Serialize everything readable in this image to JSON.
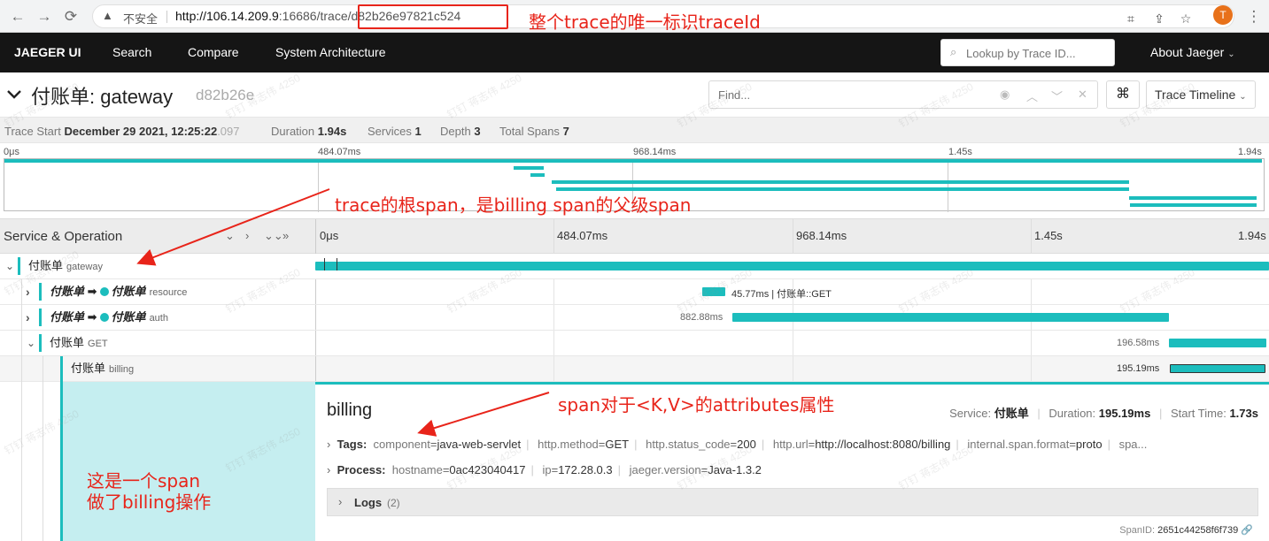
{
  "browser": {
    "insecure_label": "不安全",
    "url_host": "http://106.14.209.9",
    "url_rest": ":16686/trace/d82b26e97821c524"
  },
  "nav": {
    "brand": "JAEGER UI",
    "search": "Search",
    "compare": "Compare",
    "system_architecture": "System Architecture",
    "lookup_placeholder": "Lookup by Trace ID...",
    "about": "About Jaeger"
  },
  "trace": {
    "title": "付账单: gateway",
    "short_id": "d82b26e",
    "find_placeholder": "Find...",
    "view_mode": "Trace Timeline",
    "summary": {
      "trace_start_label": "Trace Start",
      "trace_start_value": "December 29 2021, 12:25:22",
      "trace_start_ms": ".097",
      "duration_label": "Duration",
      "duration_value": "1.94s",
      "services_label": "Services",
      "services_value": "1",
      "depth_label": "Depth",
      "depth_value": "3",
      "total_spans_label": "Total Spans",
      "total_spans_value": "7"
    }
  },
  "ticks": [
    "0μs",
    "484.07ms",
    "968.14ms",
    "1.45s",
    "1.94s"
  ],
  "timeline_header": {
    "title": "Service & Operation"
  },
  "rows": [
    {
      "service": "付账单",
      "operation": "gateway"
    },
    {
      "service": "付账单",
      "target": "付账单",
      "operation": "resource",
      "bar_label": "45.77ms | 付账单::GET"
    },
    {
      "service": "付账单",
      "target": "付账单",
      "operation": "auth",
      "bar_label": "882.88ms"
    },
    {
      "service": "付账单",
      "operation": "GET",
      "bar_label": "196.58ms"
    },
    {
      "service": "付账单",
      "operation": "billing",
      "bar_label": "195.19ms"
    }
  ],
  "detail": {
    "title": "billing",
    "service_label": "Service:",
    "service_value": "付账单",
    "duration_label": "Duration:",
    "duration_value": "195.19ms",
    "start_label": "Start Time:",
    "start_value": "1.73s",
    "tags_label": "Tags:",
    "tags": [
      {
        "k": "component",
        "v": "java-web-servlet"
      },
      {
        "k": "http.method",
        "v": "GET"
      },
      {
        "k": "http.status_code",
        "v": "200"
      },
      {
        "k": "http.url",
        "v": "http://localhost:8080/billing"
      },
      {
        "k": "internal.span.format",
        "v": "proto"
      }
    ],
    "tags_more": "spa...",
    "process_label": "Process:",
    "process": [
      {
        "k": "hostname",
        "v": "0ac423040417"
      },
      {
        "k": "ip",
        "v": "172.28.0.3"
      },
      {
        "k": "jaeger.version",
        "v": "Java-1.3.2"
      }
    ],
    "logs_label": "Logs",
    "logs_count": "(2)",
    "span_id_label": "SpanID:",
    "span_id": "2651c44258f6f739"
  },
  "annotations": {
    "trace_id": "整个trace的唯一标识traceId",
    "root_span": "trace的根span，是billing span的父级span",
    "attributes": "span对于<K,V>的attributes属性",
    "span_line1": "这是一个span",
    "span_line2": "做了billing操作"
  },
  "watermark_text": "钉钉 蒋志伟 4250",
  "colors": {
    "accent": "#1cbdbd",
    "annotation": "#e8241a",
    "nav_bg": "#151515"
  }
}
